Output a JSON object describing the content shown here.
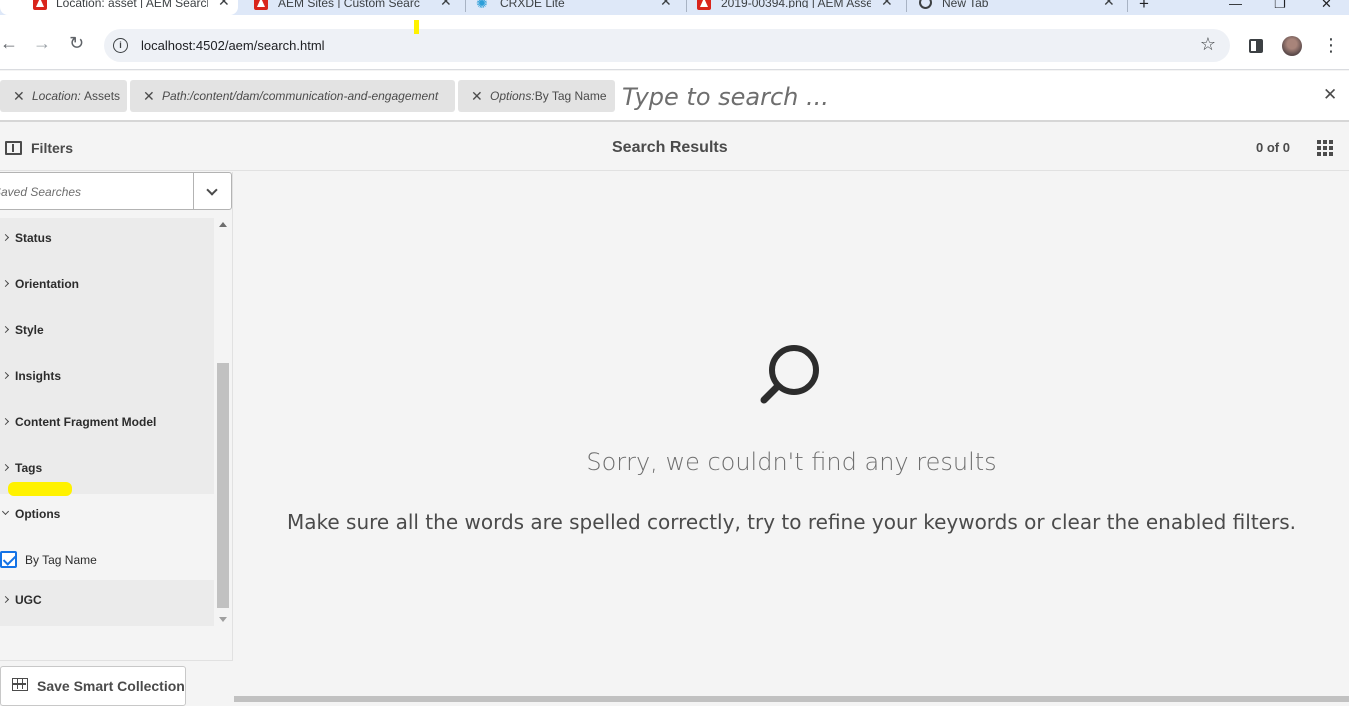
{
  "browser": {
    "tabs": [
      {
        "title": "Location: asset | AEM Search",
        "icon": "adobe-icon",
        "active": true
      },
      {
        "title": "AEM Sites | Custom Search F",
        "icon": "adobe-icon",
        "active": false
      },
      {
        "title": "CRXDE Lite",
        "icon": "crxde-icon",
        "active": false
      },
      {
        "title": "2019-00394.png | AEM Asse",
        "icon": "adobe-icon",
        "active": false
      },
      {
        "title": "New Tab",
        "icon": "chrome-icon",
        "active": false
      }
    ],
    "new_tab_glyph": "+",
    "url": "localhost:4502/aem/search.html"
  },
  "search": {
    "chips": [
      {
        "key": "Location:",
        "value": "Assets"
      },
      {
        "key": "Path:",
        "value": "/content/dam/communication-and-engagement"
      },
      {
        "key": "Options:",
        "value": "By Tag Name"
      }
    ],
    "placeholder": "Type to search ..."
  },
  "actionbar": {
    "filters_label": "Filters",
    "title": "Search Results",
    "count": "0 of 0"
  },
  "rail": {
    "saved_searches_placeholder": "Saved Searches",
    "facets": [
      "Status",
      "Orientation",
      "Style",
      "Insights",
      "Content Fragment Model",
      "Tags",
      "Options",
      "UGC"
    ],
    "options_checkbox": {
      "label": "By Tag Name",
      "checked": true
    },
    "save_smart_collection": "Save Smart Collection"
  },
  "empty_state": {
    "title": "Sorry, we couldn't find any results",
    "description": "Make sure all the words are spelled correctly, try to refine your keywords or clear the enabled filters."
  },
  "colors": {
    "accent": "#1473e6",
    "highlight": "#fff200",
    "adobe_red": "#d9251c"
  }
}
